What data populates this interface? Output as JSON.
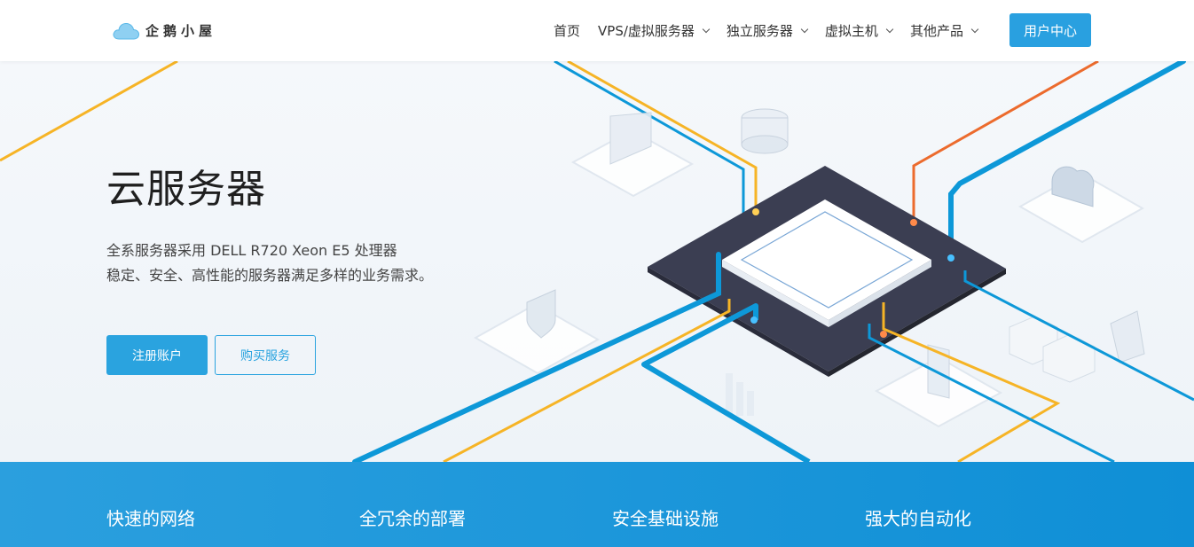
{
  "brand": {
    "logo_text": "企鹅小屋",
    "logo_icon": "cloud-icon"
  },
  "nav": {
    "items": [
      {
        "label": "首页",
        "has_dropdown": false
      },
      {
        "label": "VPS/虚拟服务器",
        "has_dropdown": true
      },
      {
        "label": "独立服务器",
        "has_dropdown": true
      },
      {
        "label": "虚拟主机",
        "has_dropdown": true
      },
      {
        "label": "其他产品",
        "has_dropdown": true
      }
    ],
    "user_center_label": "用户中心"
  },
  "hero": {
    "title": "云服务器",
    "desc_line1": "全系服务器采用 DELL R720 Xeon E5 处理器",
    "desc_line2": "稳定、安全、高性能的服务器满足多样的业务需求。",
    "register_label": "注册账户",
    "buy_label": "购买服务"
  },
  "features": {
    "items": [
      "快速的网络",
      "全冗余的部署",
      "安全基础设施",
      "强大的自动化"
    ]
  },
  "colors": {
    "accent": "#29a0e0",
    "feature_bar": "#1896d9",
    "line_blue": "#0d98d8",
    "line_yellow": "#f6b426",
    "line_orange": "#ec6b2d",
    "chip_dark": "#3b3e52"
  }
}
